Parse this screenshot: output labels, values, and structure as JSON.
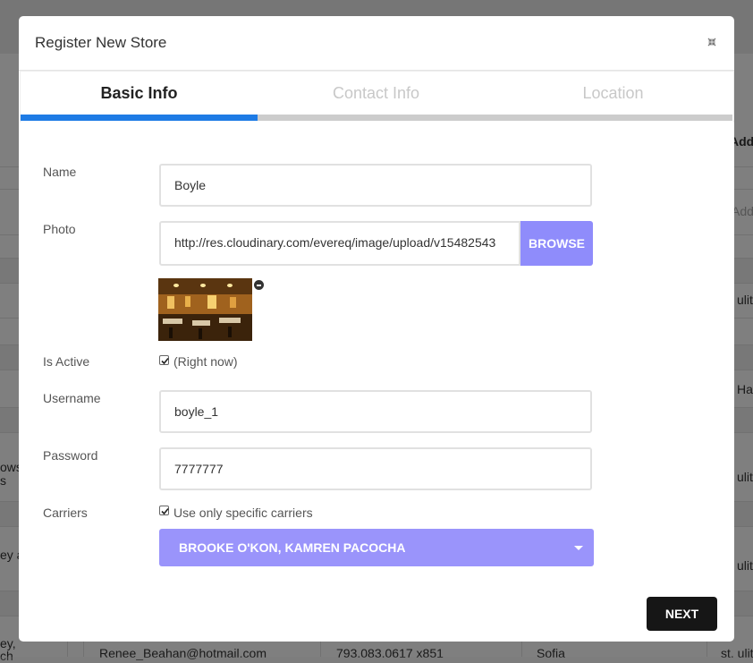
{
  "background": {
    "header_col": "Addre",
    "add_placeholder": "Add",
    "cells": [
      "ulit",
      "Ha",
      "ows",
      "s",
      "ulit",
      "ey a",
      "ulit",
      "ey,",
      "ch",
      "st. ulit"
    ],
    "row_email": "Renee_Beahan@hotmail.com",
    "row_phone": "793.083.0617 x851",
    "row_city": "Sofia"
  },
  "modal": {
    "title": "Register New Store",
    "close_icon": "collapse-icon",
    "tabs": [
      {
        "label": "Basic Info",
        "active": true
      },
      {
        "label": "Contact Info",
        "active": false
      },
      {
        "label": "Location",
        "active": false
      }
    ],
    "progress": {
      "active_color": "#1e7be5",
      "inactive_color": "#cccccc"
    },
    "form": {
      "name_label": "Name",
      "name_value": "Boyle",
      "photo_label": "Photo",
      "photo_value": "http://res.cloudinary.com/evereq/image/upload/v15482543",
      "browse_label": "BROWSE",
      "is_active_label": "Is Active",
      "is_active_checked": true,
      "is_active_text": "(Right now)",
      "username_label": "Username",
      "username_value": "boyle_1",
      "password_label": "Password",
      "password_value": "7777777",
      "carriers_label": "Carriers",
      "carriers_checked": true,
      "carriers_text": "Use only specific carriers",
      "carriers_selected": "BROOKE O'KON, KAMREN PACOCHA"
    },
    "next_label": "NEXT"
  },
  "colors": {
    "accent": "#8f8cfb",
    "select_bg": "#9a94fb",
    "tab_active": "#1e7be5",
    "next_bg": "#161616"
  }
}
